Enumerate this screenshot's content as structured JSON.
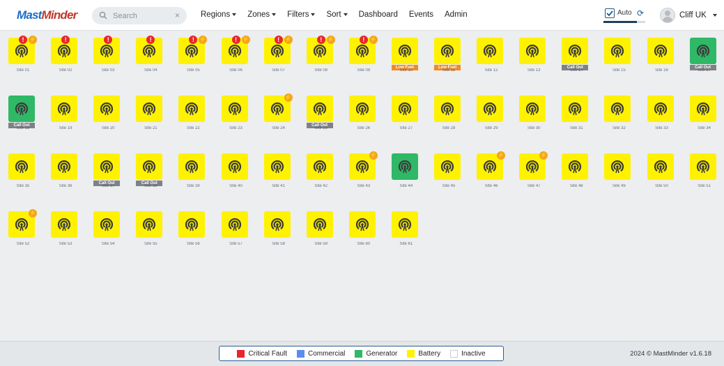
{
  "header": {
    "logo": {
      "part1": "Mast",
      "part2": "Minder"
    },
    "search": {
      "placeholder": "Search",
      "clear": "×"
    },
    "nav": [
      {
        "label": "Regions",
        "dropdown": true
      },
      {
        "label": "Zones",
        "dropdown": true
      },
      {
        "label": "Filters",
        "dropdown": true
      },
      {
        "label": "Sort",
        "dropdown": true
      },
      {
        "label": "Dashboard",
        "dropdown": false
      },
      {
        "label": "Events",
        "dropdown": false
      },
      {
        "label": "Admin",
        "dropdown": false
      }
    ],
    "auto": {
      "label": "Auto",
      "checked": true,
      "progress": 0.8
    },
    "user": {
      "name": "Cliff UK"
    }
  },
  "colors": {
    "battery": "#fff200",
    "generator": "#2fb866",
    "critical": "#e8262d",
    "warning": "#f4a51c",
    "callout": "#7e8287",
    "lowfuel": "#f08a24",
    "commercial": "#5b8def"
  },
  "sites": [
    {
      "status": "battery",
      "critical": true,
      "warning": true,
      "tag": "",
      "name": "Site 01"
    },
    {
      "status": "battery",
      "critical": true,
      "warning": false,
      "tag": "",
      "name": "Site 02"
    },
    {
      "status": "battery",
      "critical": true,
      "warning": false,
      "tag": "",
      "name": "Site 03"
    },
    {
      "status": "battery",
      "critical": true,
      "warning": false,
      "tag": "",
      "name": "Site 04"
    },
    {
      "status": "battery",
      "critical": true,
      "warning": true,
      "tag": "",
      "name": "Site 05"
    },
    {
      "status": "battery",
      "critical": true,
      "warning": true,
      "tag": "",
      "name": "Site 06"
    },
    {
      "status": "battery",
      "critical": true,
      "warning": true,
      "tag": "",
      "name": "Site 07"
    },
    {
      "status": "battery",
      "critical": true,
      "warning": true,
      "tag": "",
      "name": "Site 08"
    },
    {
      "status": "battery",
      "critical": true,
      "warning": true,
      "tag": "",
      "name": "Site 09"
    },
    {
      "status": "battery",
      "critical": false,
      "warning": false,
      "tag": "Low Fuel",
      "name": "Site 10"
    },
    {
      "status": "battery",
      "critical": false,
      "warning": false,
      "tag": "Low Fuel",
      "name": "Site 11"
    },
    {
      "status": "battery",
      "critical": false,
      "warning": false,
      "tag": "",
      "name": "Site 12"
    },
    {
      "status": "battery",
      "critical": false,
      "warning": false,
      "tag": "",
      "name": "Site 13"
    },
    {
      "status": "battery",
      "critical": false,
      "warning": false,
      "tag": "Call Out",
      "name": "Site 14"
    },
    {
      "status": "battery",
      "critical": false,
      "warning": false,
      "tag": "",
      "name": "Site 15"
    },
    {
      "status": "battery",
      "critical": false,
      "warning": false,
      "tag": "",
      "name": "Site 16"
    },
    {
      "status": "generator",
      "critical": false,
      "warning": false,
      "tag": "Call Out",
      "name": "Site 17"
    },
    {
      "status": "generator",
      "critical": false,
      "warning": false,
      "tag": "Call Out",
      "name": "Site 18"
    },
    {
      "status": "battery",
      "critical": false,
      "warning": false,
      "tag": "",
      "name": "Site 19"
    },
    {
      "status": "battery",
      "critical": false,
      "warning": false,
      "tag": "",
      "name": "Site 20"
    },
    {
      "status": "battery",
      "critical": false,
      "warning": false,
      "tag": "",
      "name": "Site 21"
    },
    {
      "status": "battery",
      "critical": false,
      "warning": false,
      "tag": "",
      "name": "Site 22"
    },
    {
      "status": "battery",
      "critical": false,
      "warning": false,
      "tag": "",
      "name": "Site 23"
    },
    {
      "status": "battery",
      "critical": false,
      "warning": true,
      "tag": "",
      "name": "Site 24"
    },
    {
      "status": "battery",
      "critical": false,
      "warning": false,
      "tag": "Call Out",
      "name": "Site 25"
    },
    {
      "status": "battery",
      "critical": false,
      "warning": false,
      "tag": "",
      "name": "Site 26"
    },
    {
      "status": "battery",
      "critical": false,
      "warning": false,
      "tag": "",
      "name": "Site 27"
    },
    {
      "status": "battery",
      "critical": false,
      "warning": false,
      "tag": "",
      "name": "Site 28"
    },
    {
      "status": "battery",
      "critical": false,
      "warning": false,
      "tag": "",
      "name": "Site 29"
    },
    {
      "status": "battery",
      "critical": false,
      "warning": false,
      "tag": "",
      "name": "Site 30"
    },
    {
      "status": "battery",
      "critical": false,
      "warning": false,
      "tag": "",
      "name": "Site 31"
    },
    {
      "status": "battery",
      "critical": false,
      "warning": false,
      "tag": "",
      "name": "Site 32"
    },
    {
      "status": "battery",
      "critical": false,
      "warning": false,
      "tag": "",
      "name": "Site 33"
    },
    {
      "status": "battery",
      "critical": false,
      "warning": false,
      "tag": "",
      "name": "Site 34"
    },
    {
      "status": "battery",
      "critical": false,
      "warning": false,
      "tag": "",
      "name": "Site 35"
    },
    {
      "status": "battery",
      "critical": false,
      "warning": false,
      "tag": "",
      "name": "Site 36"
    },
    {
      "status": "battery",
      "critical": false,
      "warning": false,
      "tag": "Call Out",
      "name": "Site 37"
    },
    {
      "status": "battery",
      "critical": false,
      "warning": false,
      "tag": "Call Out",
      "name": "Site 38"
    },
    {
      "status": "battery",
      "critical": false,
      "warning": false,
      "tag": "",
      "name": "Site 39"
    },
    {
      "status": "battery",
      "critical": false,
      "warning": false,
      "tag": "",
      "name": "Site 40"
    },
    {
      "status": "battery",
      "critical": false,
      "warning": false,
      "tag": "",
      "name": "Site 41"
    },
    {
      "status": "battery",
      "critical": false,
      "warning": false,
      "tag": "",
      "name": "Site 42"
    },
    {
      "status": "battery",
      "critical": false,
      "warning": true,
      "tag": "",
      "name": "Site 43"
    },
    {
      "status": "generator",
      "critical": false,
      "warning": false,
      "tag": "",
      "name": "Site 44"
    },
    {
      "status": "battery",
      "critical": false,
      "warning": false,
      "tag": "",
      "name": "Site 45"
    },
    {
      "status": "battery",
      "critical": false,
      "warning": true,
      "tag": "",
      "name": "Site 46"
    },
    {
      "status": "battery",
      "critical": false,
      "warning": true,
      "tag": "",
      "name": "Site 47"
    },
    {
      "status": "battery",
      "critical": false,
      "warning": false,
      "tag": "",
      "name": "Site 48"
    },
    {
      "status": "battery",
      "critical": false,
      "warning": false,
      "tag": "",
      "name": "Site 49"
    },
    {
      "status": "battery",
      "critical": false,
      "warning": false,
      "tag": "",
      "name": "Site 50"
    },
    {
      "status": "battery",
      "critical": false,
      "warning": false,
      "tag": "",
      "name": "Site 51"
    },
    {
      "status": "battery",
      "critical": false,
      "warning": true,
      "tag": "",
      "name": "Site 52"
    },
    {
      "status": "battery",
      "critical": false,
      "warning": false,
      "tag": "",
      "name": "Site 53"
    },
    {
      "status": "battery",
      "critical": false,
      "warning": false,
      "tag": "",
      "name": "Site 54"
    },
    {
      "status": "battery",
      "critical": false,
      "warning": false,
      "tag": "",
      "name": "Site 55"
    },
    {
      "status": "battery",
      "critical": false,
      "warning": false,
      "tag": "",
      "name": "Site 56"
    },
    {
      "status": "battery",
      "critical": false,
      "warning": false,
      "tag": "",
      "name": "Site 57"
    },
    {
      "status": "battery",
      "critical": false,
      "warning": false,
      "tag": "",
      "name": "Site 58"
    },
    {
      "status": "battery",
      "critical": false,
      "warning": false,
      "tag": "",
      "name": "Site 59"
    },
    {
      "status": "battery",
      "critical": false,
      "warning": false,
      "tag": "",
      "name": "Site 60"
    },
    {
      "status": "battery",
      "critical": false,
      "warning": false,
      "tag": "",
      "name": "Site 61"
    }
  ],
  "legend": [
    {
      "label": "Critical Fault",
      "color": "#e8262d"
    },
    {
      "label": "Commercial",
      "color": "#5b8def"
    },
    {
      "label": "Generator",
      "color": "#2fb866"
    },
    {
      "label": "Battery",
      "color": "#fff200"
    },
    {
      "label": "Inactive",
      "color": "#ffffff"
    }
  ],
  "footer": {
    "copyright": "2024 © MastMinder v1.6.18"
  }
}
